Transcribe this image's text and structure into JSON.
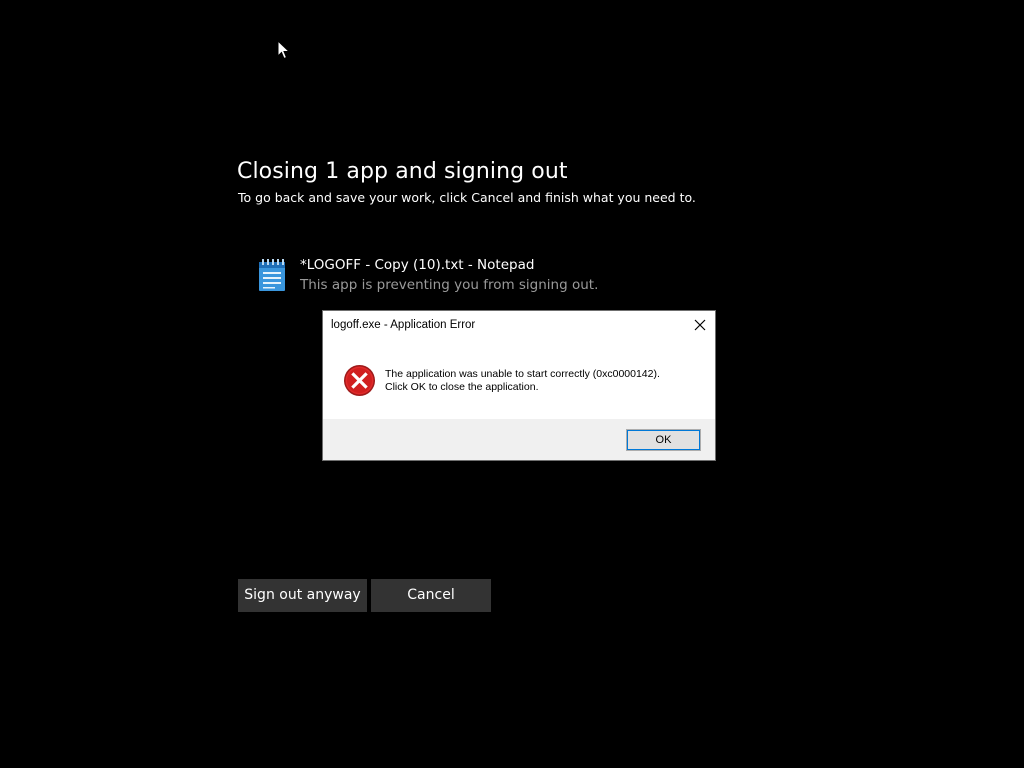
{
  "screen": {
    "title": "Closing 1 app and signing out",
    "subtitle": "To go back and save your work, click Cancel and finish what you need to.",
    "app": {
      "name": "*LOGOFF - Copy (10).txt - Notepad",
      "description": "This app is preventing you from signing out.",
      "icon": "notepad-icon"
    },
    "buttons": {
      "sign_out": "Sign out anyway",
      "cancel": "Cancel"
    }
  },
  "dialog": {
    "title": "logoff.exe - Application Error",
    "message_line1": "The application was unable to start correctly (0xc0000142).",
    "message_line2": "Click OK to close the application.",
    "ok_label": "OK",
    "icon": "error-icon",
    "close_icon": "close-icon"
  },
  "colors": {
    "background": "#000000",
    "button_bg": "#333333",
    "muted_text": "#9a9a9a",
    "error_red": "#d11f1f",
    "focus_blue": "#0078d7"
  }
}
